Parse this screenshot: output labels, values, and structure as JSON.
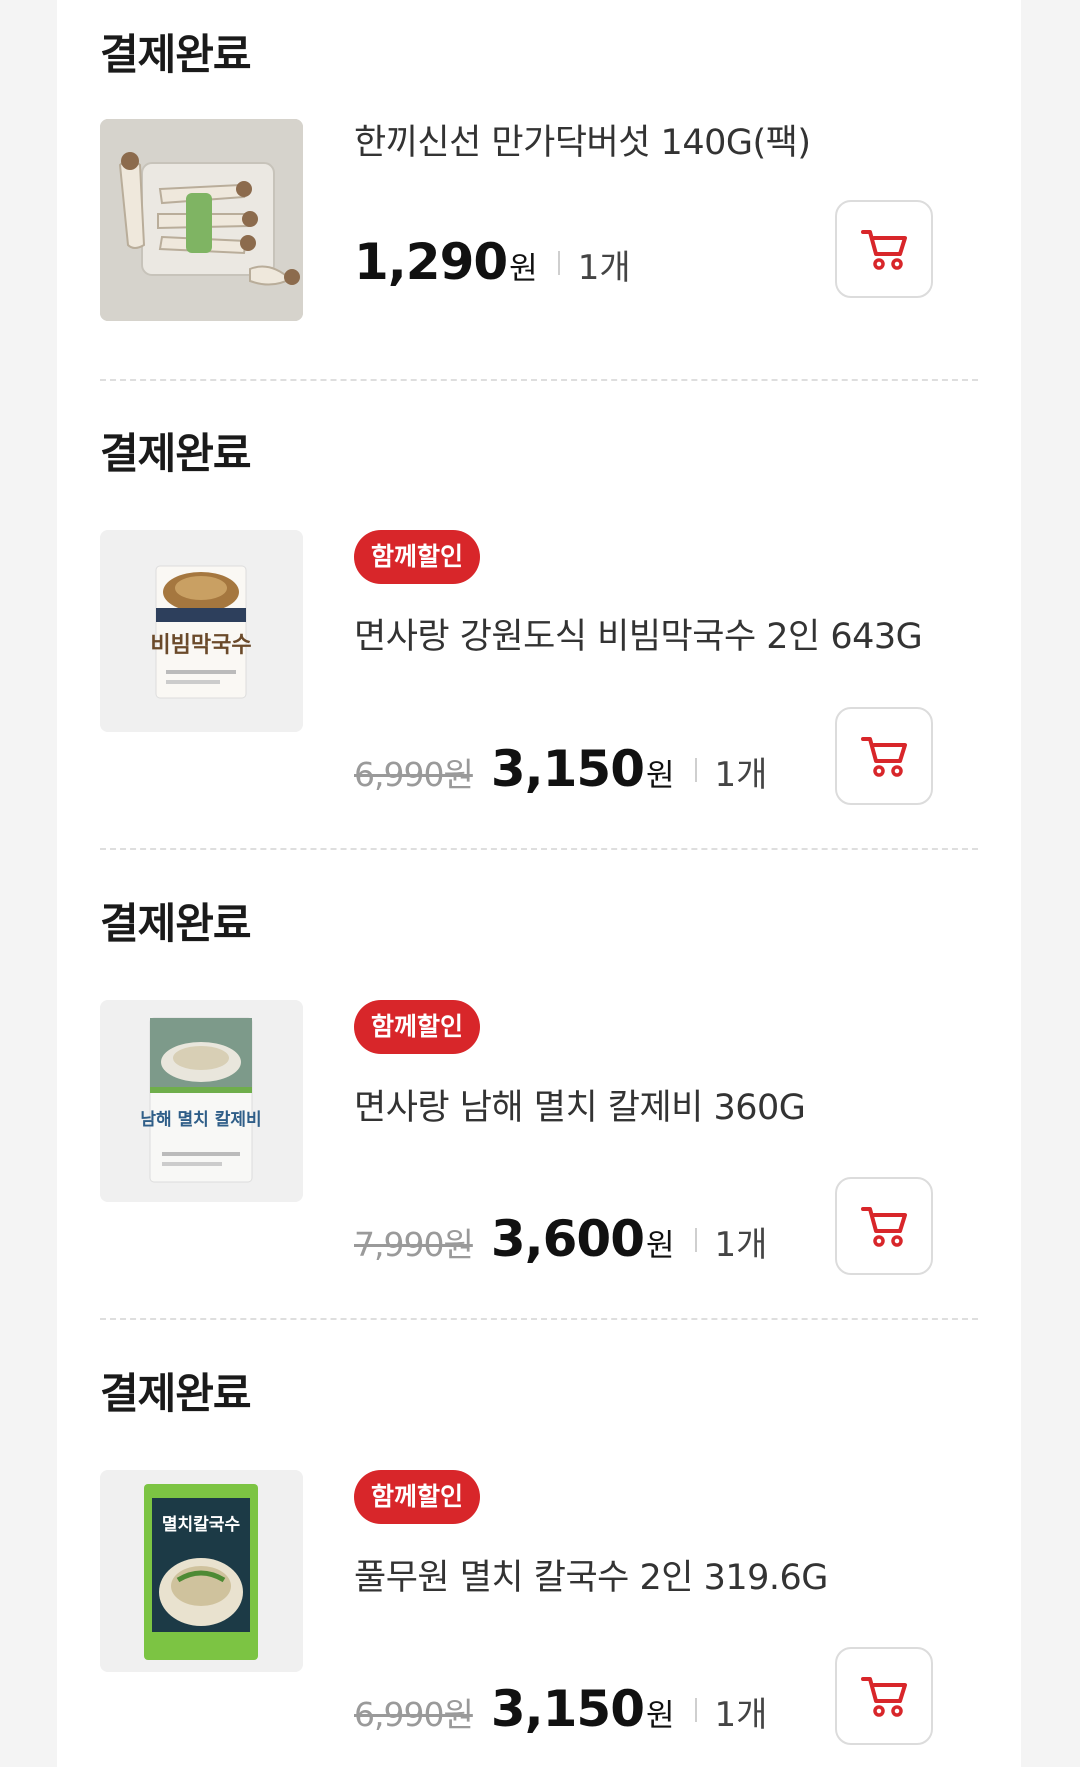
{
  "orders": [
    {
      "status": "결제완료",
      "badge": "",
      "name": "한끼신선 만가닥버섯 140G(팩)",
      "original_price": "",
      "price": "1,290",
      "currency": "원",
      "quantity": "1개",
      "image_icon": "mushroom-pack-image"
    },
    {
      "status": "결제완료",
      "badge": "함께할인",
      "name": "면사랑 강원도식 비빔막국수 2인 643G",
      "original_price": "6,990원",
      "price": "3,150",
      "currency": "원",
      "quantity": "1개",
      "image_icon": "bibim-makguksu-pack-image",
      "image_text": "비빔막국수"
    },
    {
      "status": "결제완료",
      "badge": "함께할인",
      "name": "면사랑 남해 멸치 칼제비 360G",
      "original_price": "7,990원",
      "price": "3,600",
      "currency": "원",
      "quantity": "1개",
      "image_icon": "anchovy-kaljebi-pack-image",
      "image_text": "남해 멸치 칼제비"
    },
    {
      "status": "결제완료",
      "badge": "함께할인",
      "name": "풀무원 멸치 칼국수 2인 319.6G",
      "original_price": "6,990원",
      "price": "3,150",
      "currency": "원",
      "quantity": "1개",
      "image_icon": "anchovy-kalguksu-pack-image",
      "image_text": "멸치칼국수"
    }
  ],
  "colors": {
    "accent": "#d8262a",
    "page_background": "#f4f4f4",
    "card_background": "#ffffff",
    "strikethrough_price": "#9a9a9a"
  },
  "icons": {
    "cart": "shopping-cart-icon"
  }
}
